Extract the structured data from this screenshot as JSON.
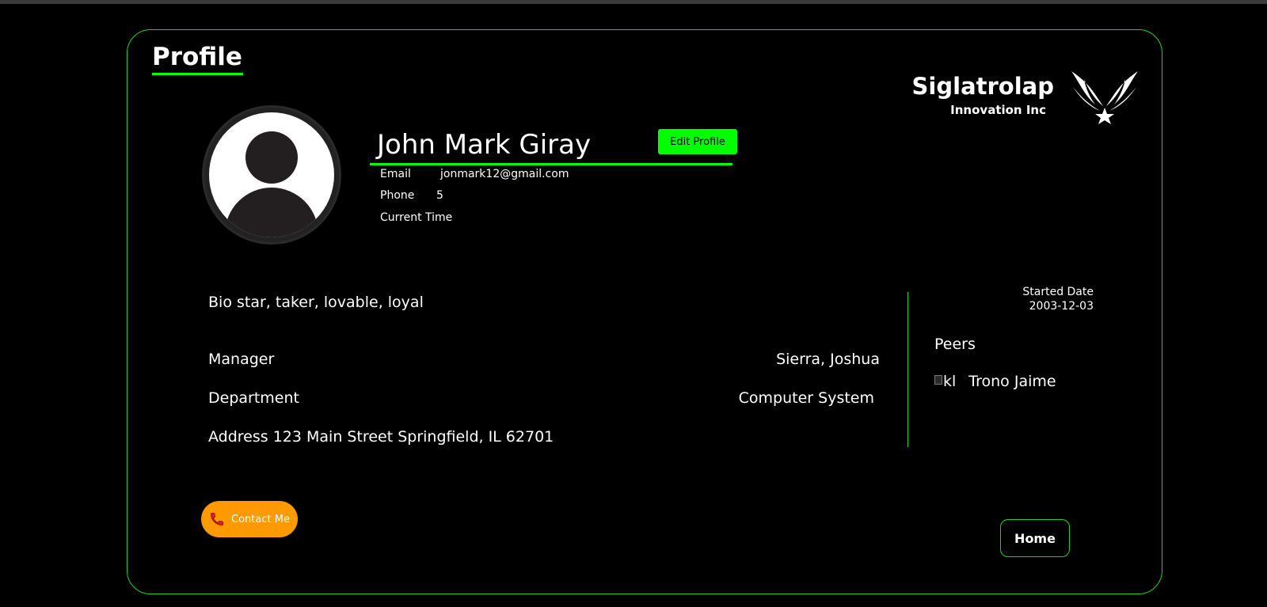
{
  "page": {
    "title": "Profile"
  },
  "brand": {
    "name": "Siglatrolap",
    "subtitle": "Innovation Inc",
    "logo_icon": "wings-star-icon"
  },
  "profile": {
    "name": "John Mark Giray",
    "edit_label": "Edit Profile",
    "email_label": "Email",
    "email_value": "jonmark12@gmail.com",
    "phone_label": "Phone",
    "phone_value": "5",
    "time_label": "Current Time",
    "time_value": ""
  },
  "details": {
    "bio_label": "Bio",
    "bio_value": "star, taker, lovable, loyal",
    "manager_label": "Manager",
    "manager_value": "Sierra, Joshua",
    "department_label": "Department",
    "department_value": "Computer System",
    "address_label": "Address",
    "address_value": "123 Main Street Springfield, IL 62701"
  },
  "sidebar": {
    "started_label": "Started Date",
    "started_value": "2003-12-03",
    "peers_label": "Peers",
    "peers": [
      {
        "alt": "kl",
        "name": "Trono Jaime"
      }
    ]
  },
  "actions": {
    "contact_label": "Contact Me",
    "home_label": "Home"
  },
  "colors": {
    "accent": "#00ff00",
    "border": "#1ed31e",
    "contact": "#ff9900",
    "background": "#000000"
  }
}
